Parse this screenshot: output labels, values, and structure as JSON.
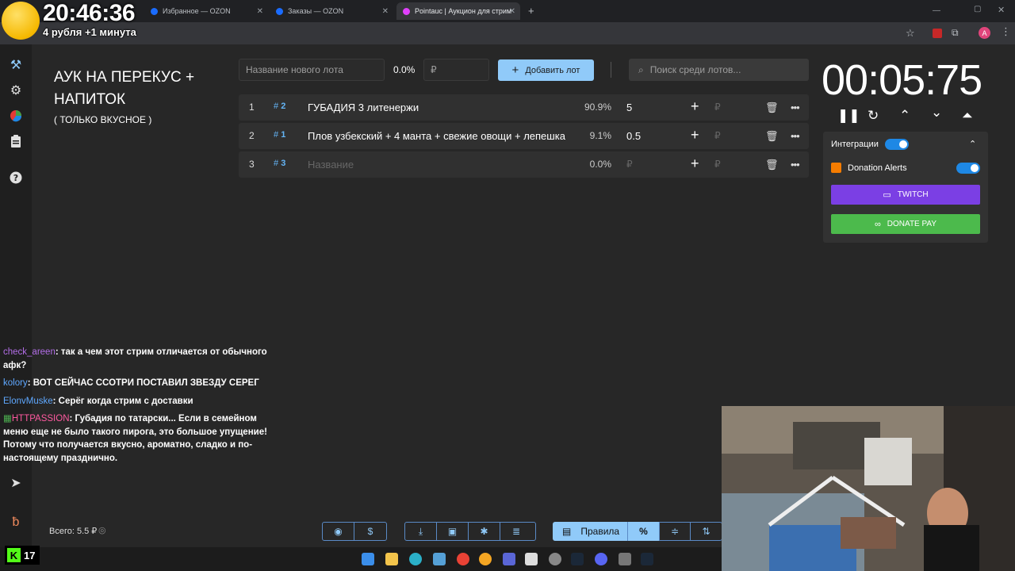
{
  "browser": {
    "tabs": [
      {
        "label": "Избранное — OZON",
        "active": false
      },
      {
        "label": "Заказы — OZON",
        "active": false
      },
      {
        "label": "Pointauc | Аукцион для стриме",
        "active": true
      }
    ],
    "new_tab": "+"
  },
  "overlay": {
    "clock": "20:46:36",
    "subtitle": "4 рубля +1 минута"
  },
  "sidebar": {
    "icons": [
      "auction-icon",
      "settings-icon",
      "pie-chart-icon",
      "clipboard-icon",
      "help-icon",
      "telegram-icon",
      "boosty-icon"
    ]
  },
  "header": {
    "title": "АУК НА ПЕРЕКУС + НАПИТОК",
    "subtitle": "( ТОЛЬКО ВКУСНОЕ )"
  },
  "new_lot": {
    "name_placeholder": "Название нового лота",
    "percent": "0.0%",
    "amount_placeholder": "₽",
    "add_button": "Добавить лот"
  },
  "search": {
    "placeholder": "Поиск среди лотов..."
  },
  "lots": [
    {
      "num": "1",
      "id": "2",
      "name": "ГУБАДИЯ 3 литенержи",
      "percent": "90.9%",
      "amount": "5",
      "placeholder": false
    },
    {
      "num": "2",
      "id": "1",
      "name": "Плов узбекский + 4 манта + свежие овощи + лепешка",
      "percent": "9.1%",
      "amount": "0.5",
      "placeholder": false
    },
    {
      "num": "3",
      "id": "3",
      "name": "Название",
      "percent": "0.0%",
      "amount": "₽",
      "placeholder": true
    }
  ],
  "timer": {
    "value": "00:05:75"
  },
  "integrations": {
    "label": "Интеграции",
    "enabled": true,
    "donation_alerts_label": "Donation Alerts",
    "donation_alerts_enabled": true,
    "twitch_button": "TWITCH",
    "donatepay_button": "DONATE PAY"
  },
  "chat": [
    {
      "user": "check_areen",
      "text": "так а чем этот стрим отличается от обычного афк?"
    },
    {
      "user": "kolory",
      "text": "ВОТ СЕЙЧАС ССОТРИ ПОСТАВИЛ ЗВЕЗДУ СЕРЕГ"
    },
    {
      "user": "ElonvMuske",
      "text": "Серёг когда стрим с доставки"
    },
    {
      "user": "HTTPASSION",
      "text": "Губадия по татарски... Если в семейном меню еще не было такого пирога, это большое упущение! Потому что получается вкусно, ароматно, сладко и по-настоящему празднично."
    }
  ],
  "footer": {
    "total": "Всего: 5.5 ₽",
    "rules_button": "Правила",
    "percent_button": "%"
  },
  "kick_badge": {
    "count": "17"
  },
  "colors": {
    "accent": "#90caf9",
    "twitch": "#7b3fe4",
    "donatepay": "#4cba4c",
    "toggle": "#1e88e5"
  }
}
